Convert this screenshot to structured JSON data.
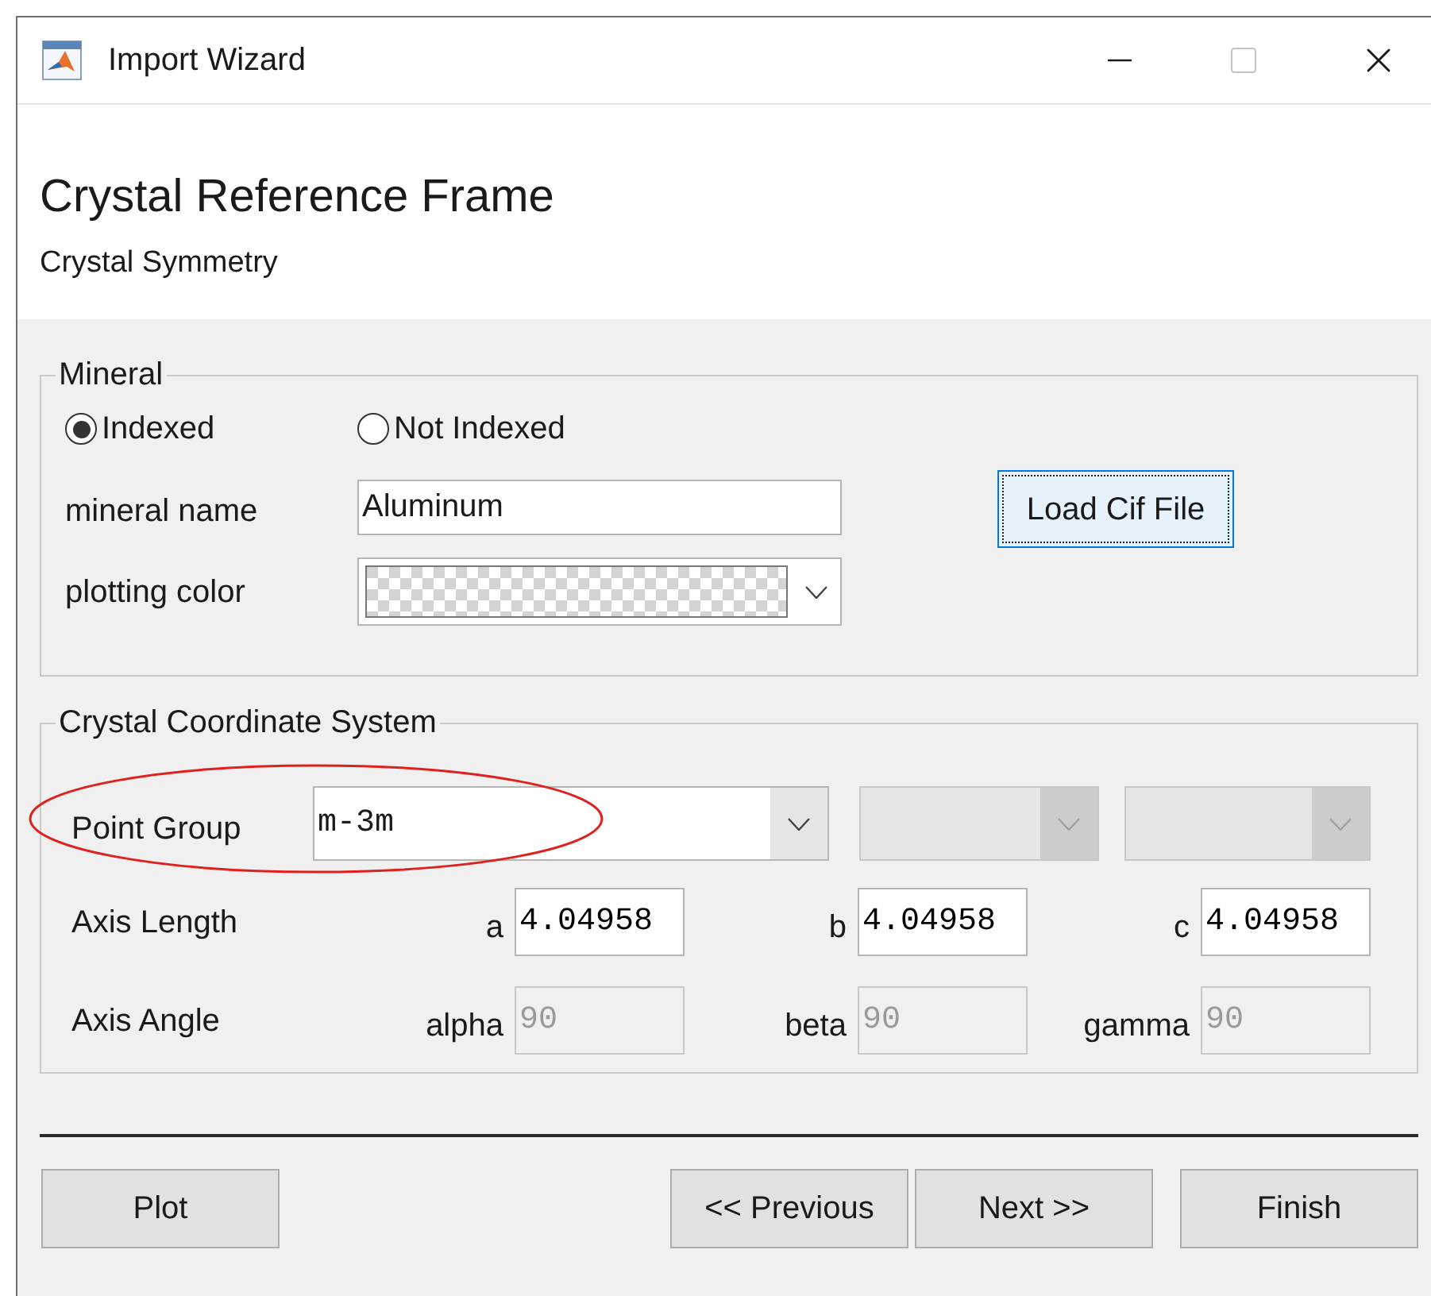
{
  "window": {
    "title": "Import Wizard"
  },
  "header": {
    "title": "Crystal Reference Frame",
    "subtitle": "Crystal Symmetry"
  },
  "mineral": {
    "legend": "Mineral",
    "options": [
      {
        "label": "Indexed",
        "selected": true
      },
      {
        "label": "Not Indexed",
        "selected": false
      }
    ],
    "name_label": "mineral name",
    "name_value": "Aluminum",
    "color_label": "plotting color",
    "load_button": {
      "label": "Load Cif File",
      "focused": true
    }
  },
  "coordinate_system": {
    "legend": "Crystal Coordinate System",
    "point_group": {
      "label": "Point Group",
      "value": "m-3m",
      "highlighted": true
    },
    "extra_selects": [
      {
        "disabled": true
      },
      {
        "disabled": true
      }
    ],
    "axis_length": {
      "label": "Axis Length",
      "fields": [
        {
          "label": "a",
          "value": "4.04958",
          "disabled": false
        },
        {
          "label": "b",
          "value": "4.04958",
          "disabled": false
        },
        {
          "label": "c",
          "value": "4.04958",
          "disabled": false
        }
      ]
    },
    "axis_angle": {
      "label": "Axis Angle",
      "fields": [
        {
          "label": "alpha",
          "value": "90",
          "disabled": true
        },
        {
          "label": "beta",
          "value": "90",
          "disabled": true
        },
        {
          "label": "gamma",
          "value": "90",
          "disabled": true
        }
      ]
    }
  },
  "left_buttons": [
    "Plot"
  ],
  "right_buttons": [
    "<< Previous",
    "Next >>",
    "Finish"
  ]
}
